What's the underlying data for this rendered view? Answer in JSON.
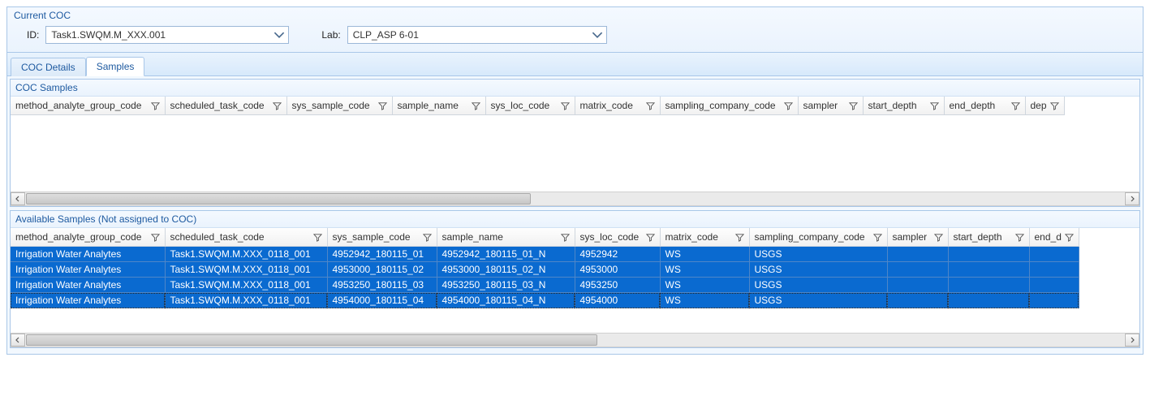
{
  "currentCoc": {
    "title": "Current COC",
    "idLabel": "ID:",
    "idValue": "Task1.SWQM.M_XXX.001",
    "labLabel": "Lab:",
    "labValue": "CLP_ASP 6-01"
  },
  "tabs": {
    "details": "COC Details",
    "samples": "Samples"
  },
  "cocSamples": {
    "title": "COC Samples",
    "columns": [
      "method_analyte_group_code",
      "scheduled_task_code",
      "sys_sample_code",
      "sample_name",
      "sys_loc_code",
      "matrix_code",
      "sampling_company_code",
      "sampler",
      "start_depth",
      "end_depth",
      "dep"
    ]
  },
  "availableSamples": {
    "title": "Available Samples (Not assigned to COC)",
    "columns": [
      "method_analyte_group_code",
      "scheduled_task_code",
      "sys_sample_code",
      "sample_name",
      "sys_loc_code",
      "matrix_code",
      "sampling_company_code",
      "sampler",
      "start_depth",
      "end_d"
    ],
    "rows": [
      {
        "method_analyte_group_code": "Irrigation Water Analytes",
        "scheduled_task_code": "Task1.SWQM.M.XXX_0118_001",
        "sys_sample_code": "4952942_180115_01",
        "sample_name": "4952942_180115_01_N",
        "sys_loc_code": "4952942",
        "matrix_code": "WS",
        "sampling_company_code": "USGS",
        "sampler": "",
        "start_depth": "",
        "end_d": ""
      },
      {
        "method_analyte_group_code": "Irrigation Water Analytes",
        "scheduled_task_code": "Task1.SWQM.M.XXX_0118_001",
        "sys_sample_code": "4953000_180115_02",
        "sample_name": "4953000_180115_02_N",
        "sys_loc_code": "4953000",
        "matrix_code": "WS",
        "sampling_company_code": "USGS",
        "sampler": "",
        "start_depth": "",
        "end_d": ""
      },
      {
        "method_analyte_group_code": "Irrigation Water Analytes",
        "scheduled_task_code": "Task1.SWQM.M.XXX_0118_001",
        "sys_sample_code": "4953250_180115_03",
        "sample_name": "4953250_180115_03_N",
        "sys_loc_code": "4953250",
        "matrix_code": "WS",
        "sampling_company_code": "USGS",
        "sampler": "",
        "start_depth": "",
        "end_d": ""
      },
      {
        "method_analyte_group_code": "Irrigation Water Analytes",
        "scheduled_task_code": "Task1.SWQM.M.XXX_0118_001",
        "sys_sample_code": "4954000_180115_04",
        "sample_name": "4954000_180115_04_N",
        "sys_loc_code": "4954000",
        "matrix_code": "WS",
        "sampling_company_code": "USGS",
        "sampler": "",
        "start_depth": "",
        "end_d": ""
      }
    ]
  }
}
